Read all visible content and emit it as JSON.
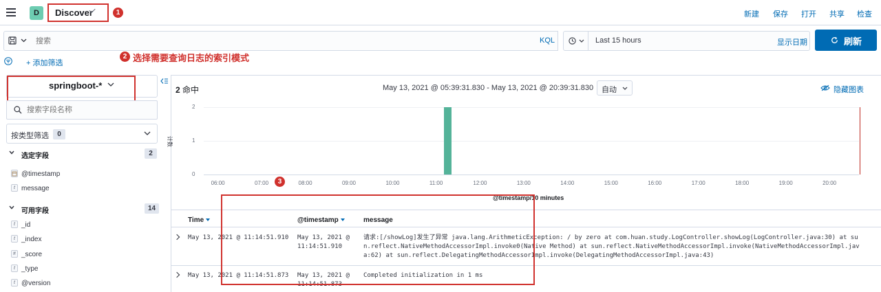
{
  "header": {
    "app_initial": "D",
    "breadcrumb": "Discover",
    "marker1": "1",
    "links": [
      "新建",
      "保存",
      "打开",
      "共享",
      "检查"
    ]
  },
  "query": {
    "placeholder": "搜索",
    "language": "KQL",
    "time_range": "Last 15 hours",
    "show_dates": "显示日期",
    "refresh": "刷新"
  },
  "filters": {
    "add_filter": "+ 添加筛选"
  },
  "annotation2": {
    "marker": "2",
    "text": "选择需要查询日志的索引模式"
  },
  "annotation3": {
    "marker": "3"
  },
  "sidebar": {
    "index_pattern": "springboot-*",
    "field_search_placeholder": "搜索字段名称",
    "filter_by_type": "按类型筛选",
    "filter_count": "0",
    "selected_title": "选定字段",
    "selected_count": "2",
    "selected_fields": [
      {
        "type": "date",
        "name": "@timestamp"
      },
      {
        "type": "t",
        "name": "message"
      }
    ],
    "available_title": "可用字段",
    "available_count": "14",
    "available_fields": [
      {
        "type": "t",
        "name": "_id"
      },
      {
        "type": "t",
        "name": "_index"
      },
      {
        "type": "#",
        "name": "_score"
      },
      {
        "type": "t",
        "name": "_type"
      },
      {
        "type": "t",
        "name": "@version"
      }
    ]
  },
  "results": {
    "hits": "2",
    "hits_label": "命中",
    "date_range": "May 13, 2021 @ 05:39:31.830 - May 13, 2021 @ 20:39:31.830",
    "interval": "自动",
    "hide_chart": "隐藏图表"
  },
  "chart_data": {
    "type": "bar",
    "ylabel": "计数",
    "xlabel": "@timestamp/10 minutes",
    "x_ticks": [
      "06:00",
      "07:00",
      "08:00",
      "09:00",
      "10:00",
      "11:00",
      "12:00",
      "13:00",
      "14:00",
      "15:00",
      "16:00",
      "17:00",
      "18:00",
      "19:00",
      "20:00"
    ],
    "y_ticks": [
      "2",
      "1",
      "0"
    ],
    "ylim": [
      0,
      2
    ],
    "x_range_hours": [
      5.66,
      20.66
    ],
    "bars": [
      {
        "start_hour": 11.1667,
        "end_hour": 11.3333,
        "value": 2
      }
    ],
    "bar_color": "#54b399",
    "now_line_color": "#bd271e"
  },
  "table": {
    "columns": [
      "Time",
      "@timestamp",
      "message"
    ],
    "rows": [
      {
        "time": "May 13, 2021 @ 11:14:51.910",
        "ts1": "May 13, 2021 @",
        "ts2": "11:14:51.910",
        "msg1": "请求:[/showLog]发生了异常 java.lang.ArithmeticException: / by zero at com.huan.study.LogController.showLog(LogController.java:30) at su",
        "msg2": "n.reflect.NativeMethodAccessorImpl.invoke0(Native Method) at sun.reflect.NativeMethodAccessorImpl.invoke(NativeMethodAccessorImpl.jav",
        "msg3": "a:62) at sun.reflect.DelegatingMethodAccessorImpl.invoke(DelegatingMethodAccessorImpl.java:43)"
      },
      {
        "time": "May 13, 2021 @ 11:14:51.873",
        "ts1": "May 13, 2021 @",
        "ts2": "11:14:51.873",
        "msg1": "Completed initialization in 1 ms"
      }
    ]
  },
  "colors": {
    "accent": "#006bb4",
    "annotation": "#d0312d"
  }
}
